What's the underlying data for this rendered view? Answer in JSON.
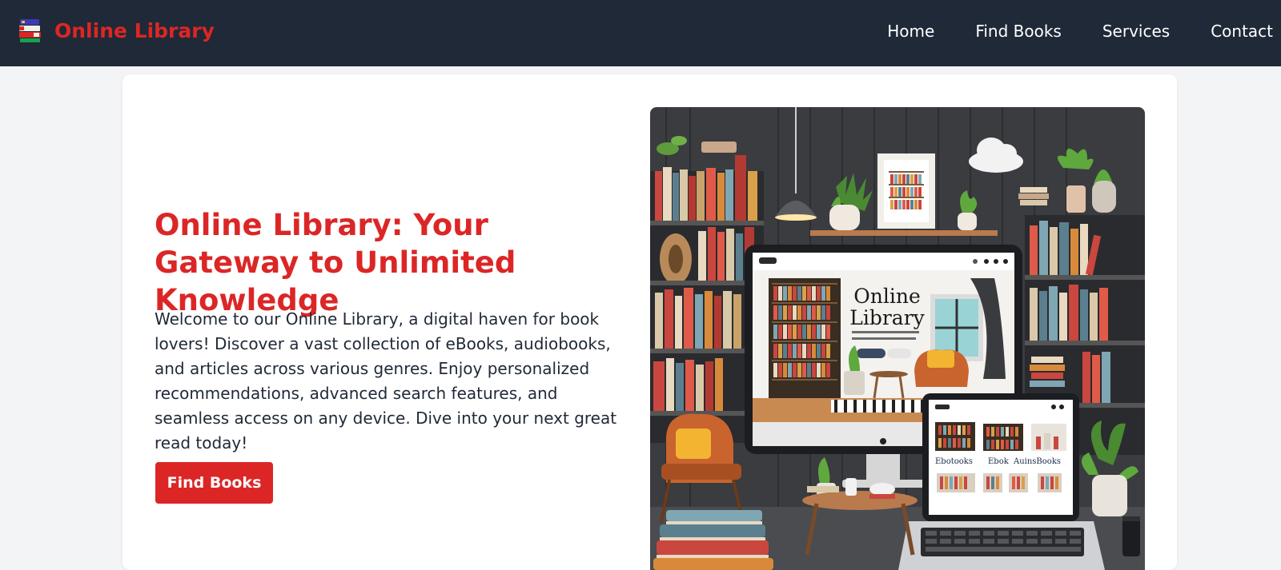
{
  "navbar": {
    "brand_name": "Online Library",
    "logo_icon": "books-icon",
    "links": [
      {
        "label": "Home"
      },
      {
        "label": "Find Books"
      },
      {
        "label": "Services"
      },
      {
        "label": "Contact"
      }
    ]
  },
  "hero": {
    "title": "Online Library: Your Gateway to Unlimited Knowledge",
    "description": "Welcome to our Online Library, a digital haven for book lovers! Discover a vast collection of eBooks, audiobooks, and articles across various genres. Enjoy personalized recommendations, advanced search features, and seamless access on any device. Dive into your next great read today!",
    "cta_label": "Find Books",
    "image": {
      "monitor_title_line1": "Online",
      "monitor_title_line2": "Library",
      "tablet_label_1": "Ebotooks",
      "tablet_label_2": "Ebok",
      "tablet_label_3": "AuinsBooks"
    }
  },
  "colors": {
    "nav_background": "#1f2937",
    "brand_red": "#dc2626",
    "page_background": "#f3f4f6",
    "card_background": "#ffffff"
  }
}
